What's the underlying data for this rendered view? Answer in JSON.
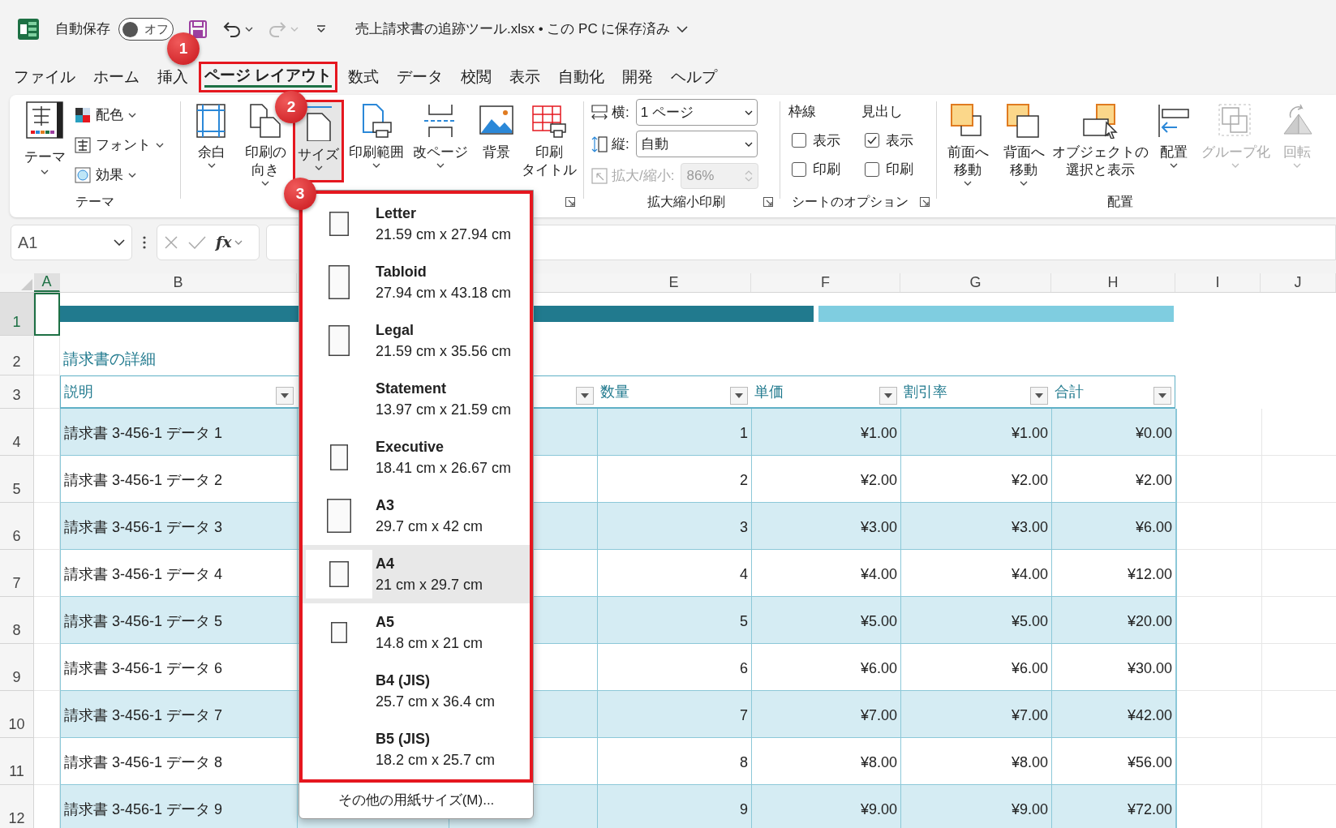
{
  "title_bar": {
    "autosave_label": "自動保存",
    "autosave_state": "オフ",
    "autosave_on": false,
    "document_title": "売上請求書の追跡ツール.xlsx • この PC に保存済み"
  },
  "tabs": [
    {
      "label": "ファイル",
      "selected": false,
      "highlighted": false
    },
    {
      "label": "ホーム",
      "selected": false,
      "highlighted": false
    },
    {
      "label": "挿入",
      "selected": false,
      "highlighted": false
    },
    {
      "label": "ページ レイアウト",
      "selected": true,
      "highlighted": true
    },
    {
      "label": "数式",
      "selected": false,
      "highlighted": false
    },
    {
      "label": "データ",
      "selected": false,
      "highlighted": false
    },
    {
      "label": "校閲",
      "selected": false,
      "highlighted": false
    },
    {
      "label": "表示",
      "selected": false,
      "highlighted": false
    },
    {
      "label": "自動化",
      "selected": false,
      "highlighted": false
    },
    {
      "label": "開発",
      "selected": false,
      "highlighted": false
    },
    {
      "label": "ヘルプ",
      "selected": false,
      "highlighted": false
    }
  ],
  "ribbon": {
    "theme_group": {
      "label": "テーマ",
      "button": "テーマ",
      "items": [
        {
          "label": "配色"
        },
        {
          "label": "フォント"
        },
        {
          "label": "効果"
        }
      ]
    },
    "page_setup_group": {
      "buttons": [
        {
          "lines": [
            "余白"
          ],
          "has_menu": true,
          "selected": false,
          "highlighted": false
        },
        {
          "lines": [
            "印刷の",
            "向き"
          ],
          "has_menu": true,
          "selected": false,
          "highlighted": false
        },
        {
          "lines": [
            "サイズ"
          ],
          "has_menu": true,
          "selected": true,
          "highlighted": true
        },
        {
          "lines": [
            "印刷範囲"
          ],
          "has_menu": true,
          "selected": false,
          "highlighted": false
        },
        {
          "lines": [
            "改ページ"
          ],
          "has_menu": true,
          "selected": false,
          "highlighted": false
        },
        {
          "lines": [
            "背景"
          ],
          "has_menu": false,
          "selected": false,
          "highlighted": false
        },
        {
          "lines": [
            "印刷",
            "タイトル"
          ],
          "has_menu": false,
          "selected": false,
          "highlighted": false
        }
      ]
    },
    "scale_group": {
      "label": "拡大縮小印刷",
      "fields": [
        {
          "label": "横:",
          "value": "1 ページ",
          "disabled": false
        },
        {
          "label": "縦:",
          "value": "自動",
          "disabled": false
        },
        {
          "label": "拡大/縮小:",
          "value": "86%",
          "disabled": true
        }
      ]
    },
    "sheet_options_group": {
      "label": "シートのオプション",
      "columns": [
        {
          "heading": "枠線",
          "options": [
            {
              "label": "表示",
              "checked": false
            },
            {
              "label": "印刷",
              "checked": false
            }
          ]
        },
        {
          "heading": "見出し",
          "options": [
            {
              "label": "表示",
              "checked": true
            },
            {
              "label": "印刷",
              "checked": false
            }
          ]
        }
      ]
    },
    "arrange_group": {
      "label": "配置",
      "buttons": [
        {
          "lines": [
            "前面へ",
            "移動"
          ],
          "has_menu": true,
          "disabled": false
        },
        {
          "lines": [
            "背面へ",
            "移動"
          ],
          "has_menu": true,
          "disabled": false
        },
        {
          "lines": [
            "オブジェクトの",
            "選択と表示"
          ],
          "has_menu": false,
          "disabled": false
        },
        {
          "lines": [
            "配置"
          ],
          "has_menu": true,
          "disabled": false
        },
        {
          "lines": [
            "グループ化"
          ],
          "has_menu": true,
          "disabled": true
        },
        {
          "lines": [
            "回転"
          ],
          "has_menu": true,
          "disabled": true
        }
      ]
    }
  },
  "formula_bar": {
    "name_box": "A1",
    "function_label": "fx"
  },
  "sheet": {
    "columns": [
      {
        "label": "A",
        "selected": true
      },
      {
        "label": "B",
        "selected": false
      },
      {
        "label": "E",
        "selected": false
      },
      {
        "label": "F",
        "selected": false
      },
      {
        "label": "G",
        "selected": false
      },
      {
        "label": "H",
        "selected": false
      },
      {
        "label": "I",
        "selected": false
      },
      {
        "label": "J",
        "selected": false
      }
    ],
    "row_numbers": [
      {
        "label": "1",
        "selected": true
      },
      {
        "label": "2",
        "selected": false
      },
      {
        "label": "3",
        "selected": false
      },
      {
        "label": "4",
        "selected": false
      },
      {
        "label": "5",
        "selected": false
      },
      {
        "label": "6",
        "selected": false
      },
      {
        "label": "7",
        "selected": false
      },
      {
        "label": "8",
        "selected": false
      },
      {
        "label": "9",
        "selected": false
      },
      {
        "label": "10",
        "selected": false
      },
      {
        "label": "11",
        "selected": false
      },
      {
        "label": "12",
        "selected": false
      }
    ],
    "title": "請求書の詳細",
    "headers": [
      {
        "text": "説明",
        "filter": true
      },
      {
        "filter": true
      },
      {
        "text": "数量",
        "filter": true
      },
      {
        "text": "単価",
        "filter": true
      },
      {
        "text": "割引率",
        "filter": true
      },
      {
        "text": "合計",
        "filter": true
      }
    ],
    "rows": [
      {
        "description": "請求書 3-456-1 データ 1",
        "quantity": "1",
        "unit_price": "¥1.00",
        "discount": "¥1.00",
        "total": "¥0.00"
      },
      {
        "description": "請求書 3-456-1 データ 2",
        "quantity": "2",
        "unit_price": "¥2.00",
        "discount": "¥2.00",
        "total": "¥2.00"
      },
      {
        "description": "請求書 3-456-1 データ 3",
        "quantity": "3",
        "unit_price": "¥3.00",
        "discount": "¥3.00",
        "total": "¥6.00"
      },
      {
        "description": "請求書 3-456-1 データ 4",
        "quantity": "4",
        "unit_price": "¥4.00",
        "discount": "¥4.00",
        "total": "¥12.00"
      },
      {
        "description": "請求書 3-456-1 データ 5",
        "quantity": "5",
        "unit_price": "¥5.00",
        "discount": "¥5.00",
        "total": "¥20.00"
      },
      {
        "description": "請求書 3-456-1 データ 6",
        "quantity": "6",
        "unit_price": "¥6.00",
        "discount": "¥6.00",
        "total": "¥30.00"
      },
      {
        "description": "請求書 3-456-1 データ 7",
        "quantity": "7",
        "unit_price": "¥7.00",
        "discount": "¥7.00",
        "total": "¥42.00"
      },
      {
        "description": "請求書 3-456-1 データ 8",
        "quantity": "8",
        "unit_price": "¥8.00",
        "discount": "¥8.00",
        "total": "¥56.00"
      },
      {
        "description": "請求書 3-456-1 データ 9",
        "quantity": "9",
        "unit_price": "¥9.00",
        "discount": "¥9.00",
        "total": "¥72.00"
      }
    ]
  },
  "size_menu": {
    "highlighted": true,
    "items": [
      {
        "name": "Letter",
        "dimensions": "21.59 cm x 27.94 cm",
        "selected": false
      },
      {
        "name": "Tabloid",
        "dimensions": "27.94 cm x 43.18 cm",
        "selected": false
      },
      {
        "name": "Legal",
        "dimensions": "21.59 cm x 35.56 cm",
        "selected": false
      },
      {
        "name": "Statement",
        "dimensions": "13.97 cm x 21.59 cm",
        "selected": false
      },
      {
        "name": "Executive",
        "dimensions": "18.41 cm x 26.67 cm",
        "selected": false
      },
      {
        "name": "A3",
        "dimensions": "29.7 cm x 42 cm",
        "selected": false
      },
      {
        "name": "A4",
        "dimensions": "21 cm x 29.7 cm",
        "selected": true
      },
      {
        "name": "A5",
        "dimensions": "14.8 cm x 21 cm",
        "selected": false
      },
      {
        "name": "B4 (JIS)",
        "dimensions": "25.7 cm x 36.4 cm",
        "selected": false
      },
      {
        "name": "B5 (JIS)",
        "dimensions": "18.2 cm x 25.7 cm",
        "selected": false
      }
    ],
    "footer": "その他の用紙サイズ(M)..."
  },
  "annotations": [
    {
      "label": "1"
    },
    {
      "label": "2"
    },
    {
      "label": "3"
    }
  ]
}
